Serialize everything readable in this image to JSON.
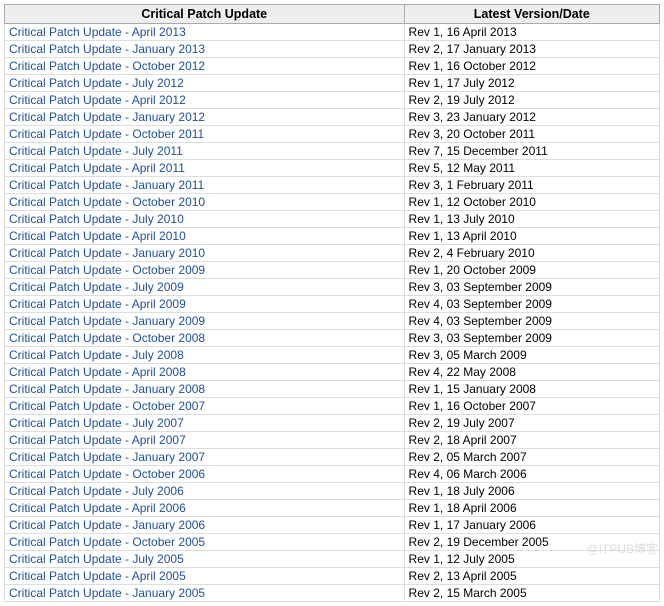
{
  "headers": {
    "name": "Critical Patch Update",
    "date": "Latest Version/Date"
  },
  "rows": [
    {
      "name": "Critical Patch Update - April 2013",
      "date": "Rev 1, 16 April 2013"
    },
    {
      "name": "Critical Patch Update - January 2013",
      "date": "Rev 2, 17 January 2013"
    },
    {
      "name": "Critical Patch Update - October 2012",
      "date": "Rev 1, 16 October 2012"
    },
    {
      "name": "Critical Patch Update - July 2012",
      "date": "Rev 1, 17 July 2012"
    },
    {
      "name": "Critical Patch Update - April 2012",
      "date": "Rev 2, 19 July 2012"
    },
    {
      "name": "Critical Patch Update - January 2012",
      "date": "Rev 3, 23 January 2012"
    },
    {
      "name": "Critical Patch Update - October 2011",
      "date": "Rev 3, 20 October 2011"
    },
    {
      "name": "Critical Patch Update - July 2011",
      "date": "Rev 7, 15 December 2011"
    },
    {
      "name": "Critical Patch Update - April 2011",
      "date": "Rev 5, 12 May 2011"
    },
    {
      "name": "Critical Patch Update - January 2011",
      "date": "Rev 3, 1 February 2011"
    },
    {
      "name": "Critical Patch Update - October 2010",
      "date": "Rev 1, 12 October 2010"
    },
    {
      "name": "Critical Patch Update - July 2010",
      "date": "Rev 1, 13 July 2010"
    },
    {
      "name": "Critical Patch Update - April 2010",
      "date": "Rev 1, 13 April 2010"
    },
    {
      "name": "Critical Patch Update - January 2010",
      "date": "Rev 2, 4 February 2010"
    },
    {
      "name": "Critical Patch Update - October 2009",
      "date": "Rev 1, 20 October 2009"
    },
    {
      "name": "Critical Patch Update - July 2009",
      "date": "Rev 3, 03 September 2009"
    },
    {
      "name": "Critical Patch Update - April 2009",
      "date": "Rev 4, 03 September 2009"
    },
    {
      "name": "Critical Patch Update - January 2009",
      "date": "Rev 4, 03 September 2009"
    },
    {
      "name": "Critical Patch Update - October 2008",
      "date": "Rev 3, 03 September 2009"
    },
    {
      "name": "Critical Patch Update - July 2008",
      "date": "Rev 3, 05 March 2009"
    },
    {
      "name": "Critical Patch Update - April 2008",
      "date": "Rev 4, 22 May 2008"
    },
    {
      "name": "Critical Patch Update - January 2008",
      "date": "Rev 1, 15 January 2008"
    },
    {
      "name": "Critical Patch Update - October 2007",
      "date": "Rev 1, 16 October 2007"
    },
    {
      "name": "Critical Patch Update - July 2007",
      "date": "Rev 2, 19 July 2007"
    },
    {
      "name": "Critical Patch Update - April 2007",
      "date": "Rev 2, 18 April 2007"
    },
    {
      "name": "Critical Patch Update - January 2007",
      "date": "Rev 2, 05 March 2007"
    },
    {
      "name": "Critical Patch Update - October 2006",
      "date": "Rev 4, 06 March 2006"
    },
    {
      "name": "Critical Patch Update - July 2006",
      "date": "Rev 1, 18 July 2006"
    },
    {
      "name": "Critical Patch Update - April 2006",
      "date": "Rev 1, 18 April 2006"
    },
    {
      "name": "Critical Patch Update - January 2006",
      "date": "Rev 1, 17 January 2006"
    },
    {
      "name": "Critical Patch Update - October 2005",
      "date": "Rev 2, 19 December 2005"
    },
    {
      "name": "Critical Patch Update - July 2005",
      "date": "Rev 1, 12 July 2005"
    },
    {
      "name": "Critical Patch Update - April 2005",
      "date": "Rev 2, 13 April 2005"
    },
    {
      "name": "Critical Patch Update - January 2005",
      "date": "Rev 2, 15 March 2005"
    }
  ],
  "watermark": "@ITPUB博客"
}
